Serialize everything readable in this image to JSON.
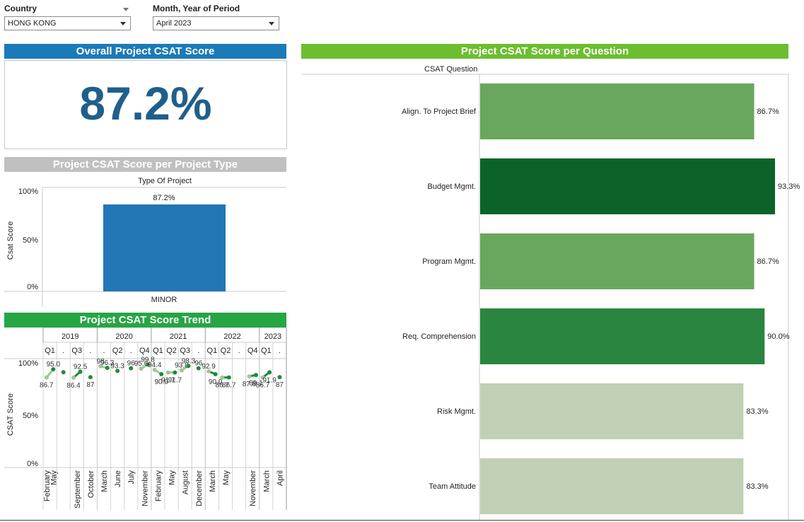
{
  "filters": {
    "country": {
      "label": "Country",
      "value": "HONG KONG"
    },
    "period": {
      "label": "Month, Year of Period",
      "value": "April 2023"
    }
  },
  "overall": {
    "title": "Overall Project CSAT Score",
    "value": "87.2%",
    "banner_color": "#1b7ab8"
  },
  "type_panel": {
    "title": "Project CSAT Score per Project Type",
    "banner_color": "#c0c0c0",
    "header": "Type Of Project",
    "ylabel": "Csat Score",
    "ticks": [
      "100%",
      "50%",
      "0%"
    ]
  },
  "trend_panel": {
    "title": "Project CSAT Score Trend",
    "banner_color": "#27a544",
    "ylabel": "CSAT Score",
    "ticks": [
      "100%",
      "50%",
      "0%"
    ]
  },
  "question_panel": {
    "title": "Project CSAT Score per Question",
    "banner_color": "#6cbe2f",
    "header": "CSAT Question"
  },
  "chart_data": [
    {
      "type": "bar",
      "categories": [
        "MINOR"
      ],
      "values": [
        87.2
      ],
      "value_labels": [
        "87.2%"
      ],
      "xlabel": "",
      "ylabel": "Csat Score",
      "ylim": [
        0,
        100
      ],
      "color": "#2277b4"
    },
    {
      "type": "bar",
      "orientation": "horizontal",
      "categories": [
        "Align. To Project Brief",
        "Budget Mgmt.",
        "Program Mgmt.",
        "Req. Comprehension",
        "Risk Mgmt.",
        "Team Attitude"
      ],
      "values": [
        86.7,
        93.3,
        86.7,
        90.0,
        83.3,
        83.3
      ],
      "value_labels": [
        "86.7%",
        "93.3%",
        "86.7%",
        "90.0%",
        "83.3%",
        "83.3%"
      ],
      "colors": [
        "#6aa75e",
        "#0b6329",
        "#6aa75e",
        "#2a8540",
        "#bfd0b5",
        "#bfd0b5"
      ],
      "xlim": [
        0,
        100
      ]
    },
    {
      "type": "line",
      "ylabel": "CSAT Score",
      "ylim": [
        0,
        100
      ],
      "years": [
        {
          "label": "2019",
          "span": 4
        },
        {
          "label": "2020",
          "span": 4
        },
        {
          "label": "2021",
          "span": 4
        },
        {
          "label": "2022",
          "span": 4
        },
        {
          "label": "2023",
          "span": 2
        }
      ],
      "quarters": [
        "Q1",
        ".",
        "Q3",
        ".",
        ".",
        "Q2",
        ".",
        "Q4",
        "Q1",
        "Q2",
        "Q3",
        ".",
        "Q1",
        "Q2",
        ".",
        "Q4",
        "Q1",
        "."
      ],
      "quarter_months": [
        [
          "February",
          "May"
        ],
        [],
        [
          "September"
        ],
        [
          "October"
        ],
        [
          "March"
        ],
        [
          "June"
        ],
        [
          "July"
        ],
        [
          "November"
        ],
        [
          "February"
        ],
        [
          "May"
        ],
        [
          "August"
        ],
        [
          "December"
        ],
        [
          "March"
        ],
        [
          "May"
        ],
        [],
        [
          "November"
        ],
        [
          "March"
        ],
        [
          "April"
        ]
      ],
      "points": [
        {
          "q": 0,
          "v": 86.7,
          "label": "86.7"
        },
        {
          "q": 0,
          "v": 95.0,
          "label": "95.0"
        },
        {
          "q": 1,
          "v": 92.0,
          "label": ""
        },
        {
          "q": 2,
          "v": 86.4,
          "label": "86.4"
        },
        {
          "q": 2,
          "v": 92.5,
          "label": "92.5"
        },
        {
          "q": 3,
          "v": 87.0,
          "label": "87"
        },
        {
          "q": 4,
          "v": 98.0,
          "label": "98"
        },
        {
          "q": 4,
          "v": 96.3,
          "label": "96.3"
        },
        {
          "q": 5,
          "v": 93.3,
          "label": "93.3"
        },
        {
          "q": 6,
          "v": 96.0,
          "label": "96"
        },
        {
          "q": 7,
          "v": 95.6,
          "label": "95.6"
        },
        {
          "q": 7,
          "v": 99.8,
          "label": "99.8"
        },
        {
          "q": 8,
          "v": 94.4,
          "label": "94.4"
        },
        {
          "q": 8,
          "v": 90.0,
          "label": "90.0"
        },
        {
          "q": 9,
          "v": 91.7,
          "label": "91.7"
        },
        {
          "q": 9,
          "v": 91.7,
          "label": "91.7"
        },
        {
          "q": 10,
          "v": 93.8,
          "label": "93.8"
        },
        {
          "q": 10,
          "v": 98.3,
          "label": "98.3"
        },
        {
          "q": 11,
          "v": 96.0,
          "label": "96"
        },
        {
          "q": 12,
          "v": 92.9,
          "label": "92.9"
        },
        {
          "q": 12,
          "v": 90.0,
          "label": "90.0"
        },
        {
          "q": 13,
          "v": 86.7,
          "label": "86.7"
        },
        {
          "q": 13,
          "v": 86.7,
          "label": "86.7"
        },
        {
          "q": 15,
          "v": 87.8,
          "label": "87.8"
        },
        {
          "q": 15,
          "v": 89.1,
          "label": "89.1"
        },
        {
          "q": 16,
          "v": 86.7,
          "label": "86.7"
        },
        {
          "q": 16,
          "v": 91.9,
          "label": "91.9"
        },
        {
          "q": 17,
          "v": 87.0,
          "label": "87"
        }
      ]
    }
  ]
}
